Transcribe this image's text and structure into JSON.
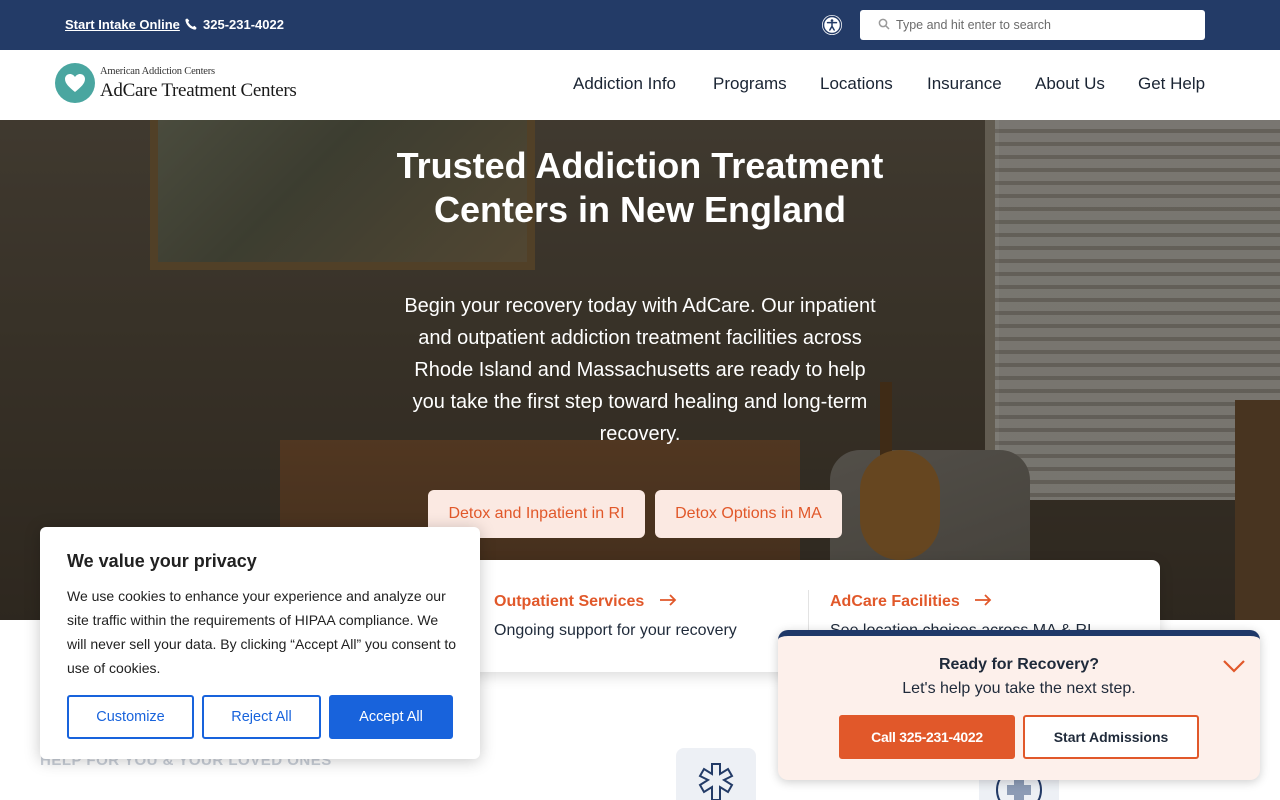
{
  "topbar": {
    "intake_link": "Start Intake Online",
    "phone": "325-231-4022",
    "search_placeholder": "Type and hit enter to search"
  },
  "logo": {
    "sub": "American Addiction Centers",
    "main": "AdCare Treatment Centers"
  },
  "nav": {
    "items": [
      "Addiction Info",
      "Programs",
      "Locations",
      "Insurance",
      "About Us",
      "Get Help"
    ]
  },
  "hero": {
    "title": "Trusted Addiction Treatment Centers in New England",
    "text": "Begin your recovery today with AdCare. Our inpatient and outpatient addiction treatment facilities across Rhode Island and Massachusetts are ready to help you take the first step toward healing and long-term recovery.",
    "buttons": [
      "Detox and Inpatient in RI",
      "Detox Options in MA"
    ]
  },
  "cards": [
    {
      "title": "Outpatient Services",
      "text": "Ongoing support for your recovery"
    },
    {
      "title": "AdCare Facilities",
      "text": "See location choices across MA & RI"
    }
  ],
  "section": {
    "label": "HELP FOR YOU & YOUR LOVED ONES"
  },
  "cookie": {
    "title": "We value your privacy",
    "body": "We use cookies to enhance your experience and analyze our site traffic within the requirements of HIPAA compliance. We will never sell your data. By clicking “Accept All” you consent to use of cookies.",
    "customize": "Customize",
    "reject": "Reject All",
    "accept": "Accept All"
  },
  "widget": {
    "title": "Ready for Recovery?",
    "subtitle": "Let's help you take the next step.",
    "call": "Call 325-231-4022",
    "admissions": "Start Admissions"
  },
  "colors": {
    "navy": "#233b67",
    "accent_orange": "#e1582a",
    "cookie_blue": "#1863dc",
    "logo_teal": "#4aa6a0"
  }
}
